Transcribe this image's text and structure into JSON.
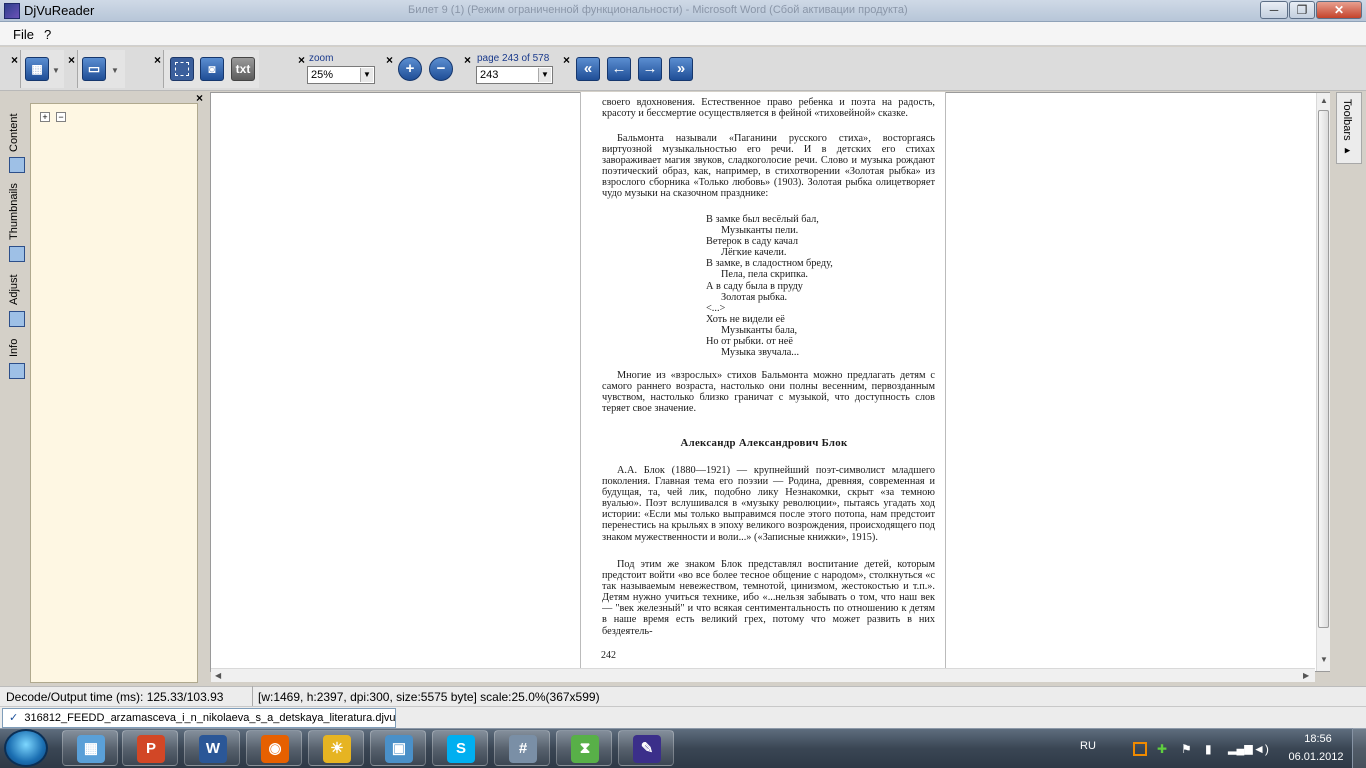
{
  "window": {
    "app_title": "DjVuReader",
    "background_title": "Билет 9 (1) (Режим ограниченной функциональности) - Microsoft Word (Сбой активации продукта)",
    "minimize": "─",
    "maximize": "❐",
    "close": "✕"
  },
  "menu": {
    "file": "File",
    "help": "?"
  },
  "toolbar": {
    "close_glyph": "×",
    "zoom_label": "zoom",
    "zoom_value": "25%",
    "page_label": "page 243 of 578",
    "page_value": "243",
    "txt_label": "txt"
  },
  "sidebar": {
    "tabs": [
      "Content",
      "Thumbnails",
      "Adjust",
      "Info"
    ],
    "expand": "+",
    "collapse": "−",
    "close": "×"
  },
  "right_panel": {
    "toolbars_label": "Toolbars ▸"
  },
  "page": {
    "p1": "своего вдохновения. Естественное право ребенка и поэта на радость, красоту и бессмертие осуществляется в фейной «тиховейной» сказке.",
    "p2": "Бальмонта называли «Паганини русского стиха», восторгаясь виртуозной музыкальностью его речи. И в детских его стихах завораживает магия звуков, сладкоголосие речи. Слово и музыка рождают поэтический образ, как, например, в стихотворении «Золотая рыбка» из взрослого сборника «Только любовь» (1903). Золотая рыбка олицетворяет чудо музыки на сказочном празднике:",
    "verse": [
      {
        "text": "В замке был весёлый бал,",
        "indent": false
      },
      {
        "text": "Музыканты пели.",
        "indent": true
      },
      {
        "text": "Ветерок в саду качал",
        "indent": false
      },
      {
        "text": "Лёгкие качели.",
        "indent": true
      },
      {
        "text": "В замке, в сладостном бреду,",
        "indent": false
      },
      {
        "text": "Пела, пела скрипка.",
        "indent": true
      },
      {
        "text": "А в саду была в пруду",
        "indent": false
      },
      {
        "text": "Золотая рыбка.",
        "indent": true
      },
      {
        "text": "<...>",
        "indent": false
      },
      {
        "text": "Хоть не видели её",
        "indent": false
      },
      {
        "text": "Музыканты бала,",
        "indent": true
      },
      {
        "text": "Но от рыбки. от неё",
        "indent": false
      },
      {
        "text": "Музыка звучала...",
        "indent": true
      }
    ],
    "p3": "Многие из «взрослых» стихов Бальмонта можно предлагать детям с самого раннего возраста, настолько они полны весенним, первозданным чувством, настолько близко граничат с музыкой, что доступность слов теряет свое значение.",
    "section_title": "Александр Александрович Блок",
    "p4": "А.А. Блок (1880—1921) — крупнейший поэт-символист младшего поколения. Главная тема его поэзии — Родина, древняя, современная и будущая, та, чей лик, подобно лику Незнакомки, скрыт «за темною вуалью». Поэт вслушивался в «музыку революции», пытаясь угадать ход истории: «Если мы только выправимся после этого потопа, нам предстоит перенестись на крыльях в эпоху великого возрождения, происходящего под знаком мужественности и воли...» («Записные книжки», 1915).",
    "p5": "Под этим же знаком Блок представлял воспитание детей, которым предстоит войти «во все более тесное общение с народом», столкнуться «с так называемым невежеством, темнотой, цинизмом, жестокостью и т.п.». Детям нужно учиться технике, ибо «...нельзя забывать о том, что наш век — \"век железный\" и что всякая сентиментальность по отношению к детям в наше время есть великий грех, потому что может развить в них бездеятель-",
    "page_number": "242"
  },
  "status": {
    "decode": "Decode/Output time (ms): 125.33/103.93",
    "info": "[w:1469, h:2397, dpi:300, size:5575 byte] scale:25.0%(367x599)"
  },
  "doc_tab": {
    "filename": "316812_FEEDD_arzamasceva_i_n_nikolaeva_s_a_detskaya_literatura.djvu"
  },
  "taskbar": {
    "apps": [
      {
        "name": "taskbar-app-files",
        "glyph": "▦",
        "color": "#5aa0d8"
      },
      {
        "name": "taskbar-app-powerpoint",
        "glyph": "P",
        "color": "#d24726"
      },
      {
        "name": "taskbar-app-word",
        "glyph": "W",
        "color": "#2b5797"
      },
      {
        "name": "taskbar-app-firefox",
        "glyph": "◉",
        "color": "#e66000"
      },
      {
        "name": "taskbar-app-weather",
        "glyph": "☀",
        "color": "#e6b422"
      },
      {
        "name": "taskbar-app-remote",
        "glyph": "▣",
        "color": "#4a90c8"
      },
      {
        "name": "taskbar-app-skype",
        "glyph": "S",
        "color": "#00aff0"
      },
      {
        "name": "taskbar-app-calculator",
        "glyph": "#",
        "color": "#7a8fa6"
      },
      {
        "name": "taskbar-app-hourglass",
        "glyph": "⧗",
        "color": "#58b048"
      },
      {
        "name": "taskbar-app-djvureader",
        "glyph": "✎",
        "color": "#3b2f8a"
      }
    ],
    "language": "RU",
    "time": "18:56",
    "date": "06.01.2012"
  }
}
